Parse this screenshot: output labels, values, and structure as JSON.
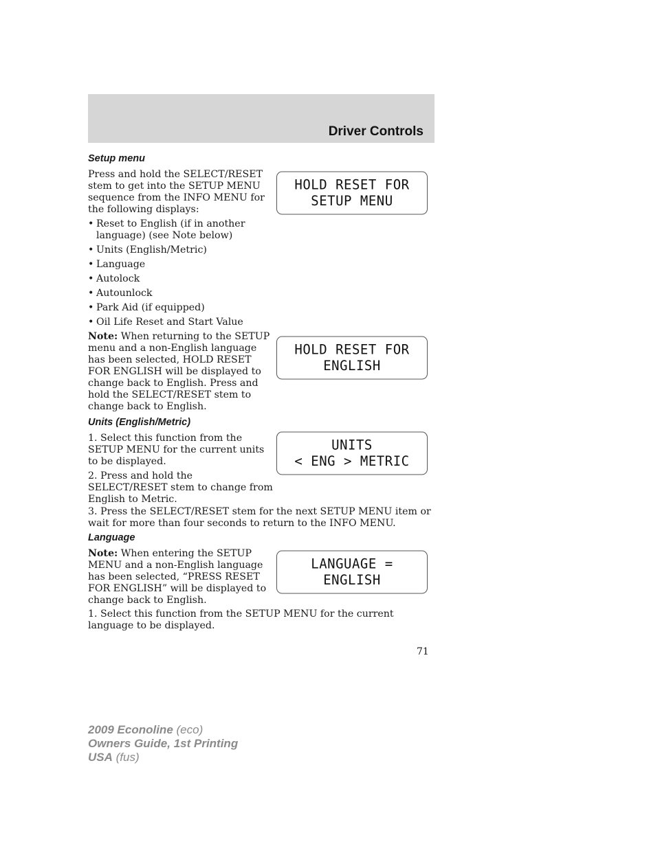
{
  "header": {
    "section_title": "Driver Controls"
  },
  "setup_menu": {
    "heading": "Setup menu",
    "intro": "Press and hold the SELECT/RESET stem to get into the SETUP MENU sequence from the INFO MENU for the following displays:",
    "bullets": [
      "Reset to English (if in another language) (see Note below)",
      "Units (English/Metric)",
      "Language",
      "Autolock",
      "Autounlock",
      "Park Aid (if equipped)",
      "Oil Life Reset and Start Value"
    ],
    "note_label": "Note:",
    "note_text": "When returning to the SETUP menu and a non-English language has been selected, HOLD RESET FOR ENGLISH will be displayed to change back to English. Press and hold the SELECT/RESET stem to change back to English."
  },
  "units": {
    "heading": "Units (English/Metric)",
    "step1": "1. Select this function from the SETUP MENU for the current units to be displayed.",
    "step2": "2. Press and hold the SELECT/RESET stem to change from English to Metric.",
    "step3": "3. Press the SELECT/RESET stem for the next SETUP MENU item or wait for more than four seconds to return to the INFO MENU."
  },
  "language": {
    "heading": "Language",
    "note_label": "Note:",
    "note_text": "When entering the SETUP MENU and a non-English language has been selected, “PRESS RESET FOR ENGLISH” will be displayed to change back to English.",
    "step1": "1. Select this function from the SETUP MENU for the current language to be displayed."
  },
  "displays": [
    {
      "line1": "HOLD RESET FOR",
      "line2": "SETUP MENU"
    },
    {
      "line1": "HOLD RESET FOR",
      "line2": "ENGLISH"
    },
    {
      "line1": "UNITS",
      "line2": "< ENG > METRIC"
    },
    {
      "line1": "LANGUAGE =",
      "line2": "ENGLISH"
    }
  ],
  "page_number": "71",
  "footer": {
    "line1_bold": "2009 Econoline",
    "line1_code": "(eco)",
    "line2": "Owners Guide, 1st Printing",
    "line3_bold": "USA",
    "line3_code": "(fus)"
  }
}
